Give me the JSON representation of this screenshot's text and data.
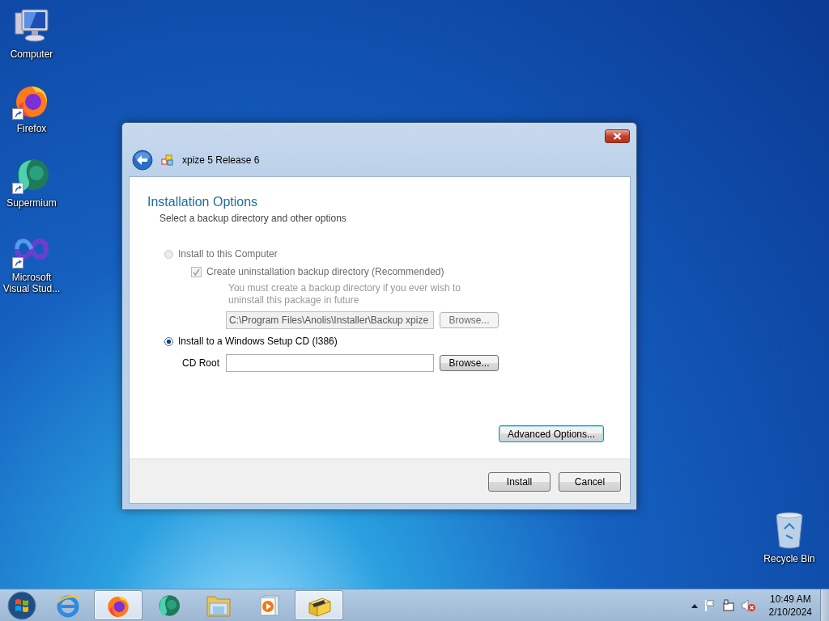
{
  "desktop_icons": [
    {
      "label": "Computer",
      "kind": "computer",
      "shortcut": false
    },
    {
      "label": "Firefox",
      "kind": "firefox",
      "shortcut": true
    },
    {
      "label": "Supermium",
      "kind": "supermium",
      "shortcut": true
    },
    {
      "label": "Microsoft Visual Stud...",
      "kind": "visualstudio",
      "shortcut": true
    }
  ],
  "recycle_bin": {
    "label": "Recycle Bin"
  },
  "dialog": {
    "title": "xpize 5 Release 6",
    "heading": "Installation Options",
    "subheading": "Select a backup directory and other options",
    "install_computer": {
      "label": "Install to this Computer",
      "selected": false,
      "disabled": true
    },
    "backup_checkbox": {
      "label": "Create uninstallation backup directory (Recommended)",
      "checked": true,
      "disabled": true
    },
    "backup_note": "You must create a backup directory if you ever wish to uninstall this package in future",
    "backup_path": {
      "value": "C:\\Program Files\\Anolis\\Installer\\Backup xpize",
      "disabled": true
    },
    "backup_browse": {
      "label": "Browse...",
      "disabled": true
    },
    "install_cd": {
      "label": "Install to a Windows Setup CD (I386)",
      "selected": true,
      "disabled": false
    },
    "cd_root": {
      "label": "CD Root"
    },
    "cd_browse": {
      "label": "Browse..."
    },
    "advanced_button": "Advanced Options...",
    "buttons": [
      "Install",
      "Cancel"
    ]
  },
  "taskbar": {
    "items": [
      {
        "kind": "ie",
        "active": false
      },
      {
        "kind": "firefox",
        "active": true
      },
      {
        "kind": "supermium",
        "active": false
      },
      {
        "kind": "explorer",
        "active": false
      },
      {
        "kind": "media",
        "active": false
      },
      {
        "kind": "installer",
        "active": true
      }
    ],
    "time": "10:49 AM",
    "date": "2/10/2024"
  }
}
